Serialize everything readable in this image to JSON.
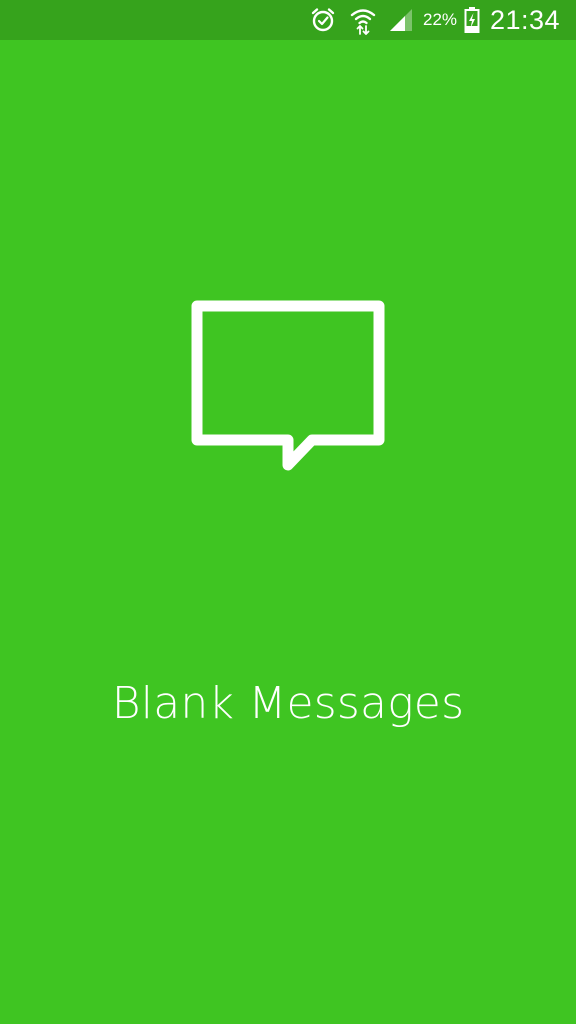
{
  "status_bar": {
    "battery_percent": "22%",
    "time": "21:34",
    "icons": [
      "alarm-icon",
      "wifi-data-icon",
      "signal-icon",
      "battery-charging-icon"
    ]
  },
  "splash": {
    "icon": "message-bubble-icon",
    "title": "Blank Messages"
  },
  "colors": {
    "background": "#3fc522",
    "status_bar": "#36a31c",
    "foreground": "#ffffff"
  }
}
